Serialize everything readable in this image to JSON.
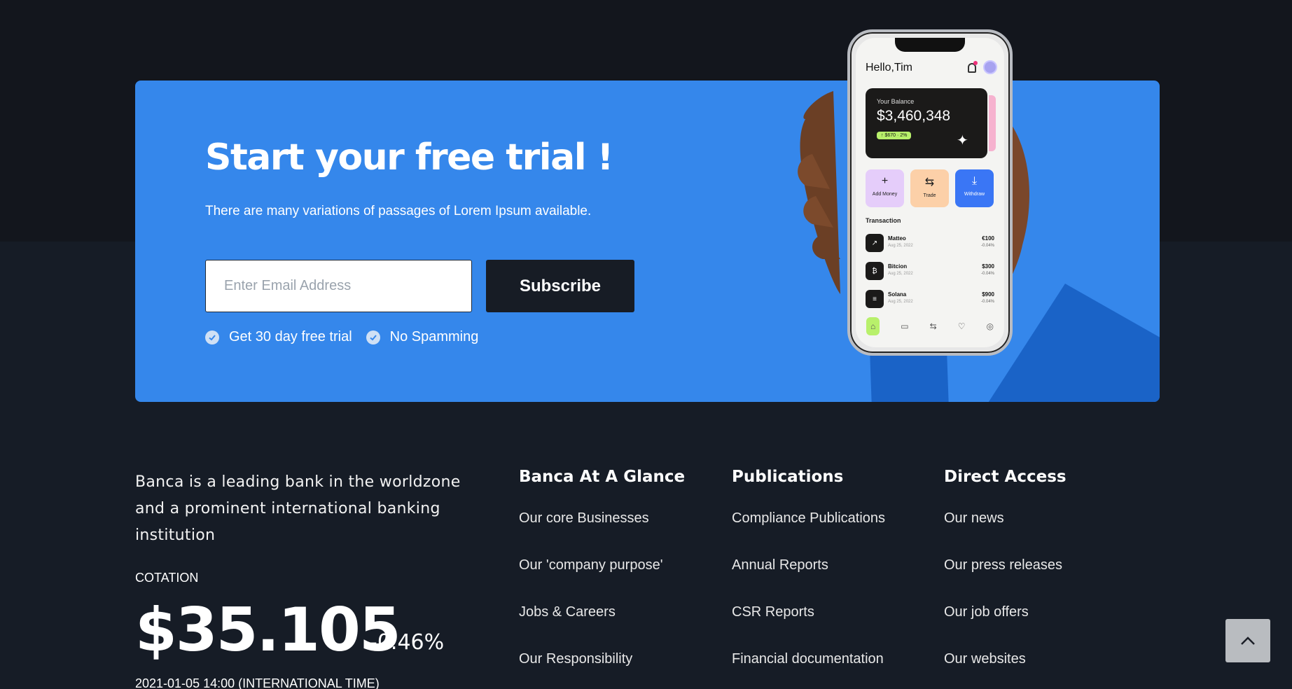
{
  "cta": {
    "title": "Start your free trial !",
    "subtitle": "There are many variations of passages of Lorem Ipsum available.",
    "email_placeholder": "Enter Email Address",
    "subscribe_label": "Subscribe",
    "perks": [
      "Get 30 day free trial",
      "No Spamming"
    ]
  },
  "phone": {
    "greeting": "Hello,Tim",
    "balance_label": "Your Balance",
    "balance": "$3,460,348",
    "balance_change": "↑ $670 · 2%",
    "actions": [
      {
        "label": "Add Money",
        "glyph": "+",
        "color": "#e5cdfa"
      },
      {
        "label": "Trade",
        "glyph": "⇆",
        "color": "#fcd0a8"
      },
      {
        "label": "Withdraw",
        "glyph": "⤓",
        "color": "#3a76f5"
      }
    ],
    "transactions_title": "Transaction",
    "transactions": [
      {
        "name": "Matteo",
        "date": "Aug 25, 2022",
        "amount": "€100",
        "pct": "-0.04%"
      },
      {
        "name": "Bitcion",
        "date": "Aug 25, 2022",
        "amount": "$300",
        "pct": "-0.04%"
      },
      {
        "name": "Solana",
        "date": "Aug 25, 2022",
        "amount": "$900",
        "pct": "-0.04%"
      }
    ]
  },
  "footer": {
    "about": "Banca is a leading bank in the worldzone and a prominent international banking institution",
    "cotation_label": "COTATION",
    "price": "$35.105",
    "change": "-0.46%",
    "date": "2021-01-05 14:00 (INTERNATIONAL TIME)",
    "columns": [
      {
        "title": "Banca At A Glance",
        "links": [
          "Our core Businesses",
          "Our 'company purpose'",
          "Jobs & Careers",
          "Our Responsibility"
        ]
      },
      {
        "title": "Publications",
        "links": [
          "Compliance Publications",
          "Annual Reports",
          "CSR Reports",
          "Financial documentation"
        ]
      },
      {
        "title": "Direct Access",
        "links": [
          "Our news",
          "Our press releases",
          "Our job offers",
          "Our websites"
        ]
      }
    ]
  },
  "colors": {
    "cta_blue": "#3587eb",
    "dark_bg": "#161c26",
    "top_band": "#13161d",
    "button_dark": "#171c25"
  },
  "icons": {
    "check": "check-circle-icon",
    "scroll_top": "chevron-up-icon"
  }
}
